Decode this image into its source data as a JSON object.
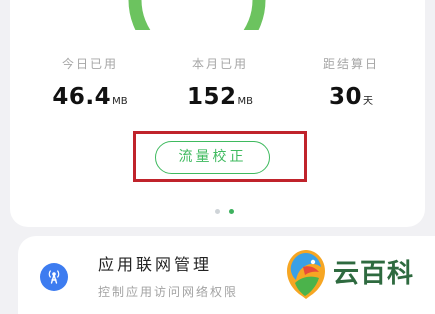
{
  "colors": {
    "accent": "#3fba5f",
    "highlight_box": "#c0232b",
    "app_icon": "#3d7cf0",
    "watermark_text": "#2e6a3f"
  },
  "stats": [
    {
      "label": "今日已用",
      "value": "46.4",
      "unit": "MB"
    },
    {
      "label": "本月已用",
      "value": "152",
      "unit": "MB"
    },
    {
      "label": "距结算日",
      "value": "30",
      "unit": "天"
    }
  ],
  "calibrate_button": {
    "label": "流量校正"
  },
  "pager": {
    "count": 2,
    "active_index": 2
  },
  "app_network": {
    "icon": "signal-tower-icon",
    "title": "应用联网管理",
    "subtitle": "控制应用访问网络权限"
  },
  "watermark": {
    "icon": "yunbaike-logo-icon",
    "text": "云百科"
  }
}
